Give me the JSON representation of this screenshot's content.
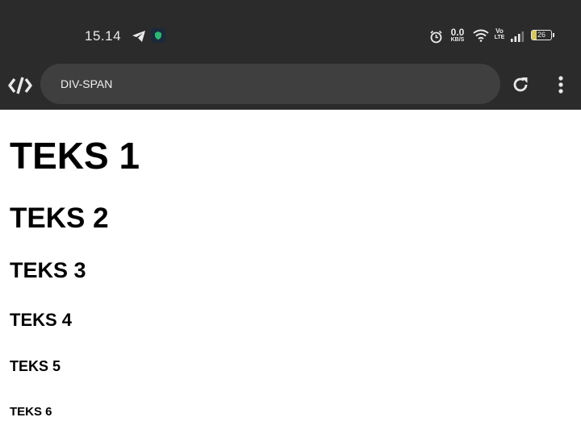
{
  "status_bar": {
    "time": "15.14",
    "net_speed_value": "0.0",
    "net_speed_unit": "KB/S",
    "volte_top": "Vo",
    "volte_bottom": "LTE",
    "battery_level": "26",
    "icons": [
      "telegram-icon",
      "shield-app-icon",
      "alarm-icon",
      "wifi-icon",
      "signal-icon",
      "battery-icon"
    ]
  },
  "browser": {
    "url": "DIV-SPAN",
    "icons": [
      "code-logo-icon",
      "reload-icon",
      "more-vertical-icon"
    ]
  },
  "page": {
    "headings": [
      "TEKS 1",
      "TEKS 2",
      "TEKS 3",
      "TEKS 4",
      "TEKS 5",
      "TEKS 6"
    ]
  },
  "colors": {
    "chrome_background": "#2b2b2b",
    "url_bar_background": "#3f3f3f",
    "page_background": "#ffffff",
    "heading_text": "#000000"
  }
}
